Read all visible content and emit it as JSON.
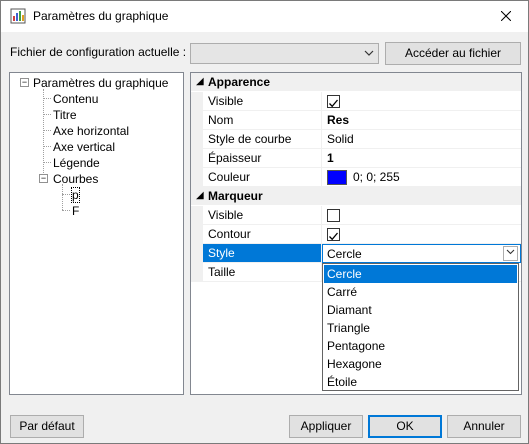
{
  "window": {
    "title": "Paramètres du graphique",
    "close_icon": "close-icon",
    "app_icon": "chart-icon"
  },
  "config": {
    "label": "Fichier de configuration actuelle :",
    "combo_value": "",
    "access_button": "Accéder au fichier"
  },
  "tree": {
    "root": "Paramètres du graphique",
    "items": [
      "Contenu",
      "Titre",
      "Axe horizontal",
      "Axe vertical",
      "Légende",
      "Courbes"
    ],
    "curves": [
      "p",
      "F"
    ],
    "selected": "p"
  },
  "grid": {
    "apparence": {
      "header": "Apparence",
      "visible_label": "Visible",
      "visible_checked": true,
      "nom_label": "Nom",
      "nom_value": "Res",
      "style_courbe_label": "Style de courbe",
      "style_courbe_value": "Solid",
      "epaisseur_label": "Épaisseur",
      "epaisseur_value": "1",
      "couleur_label": "Couleur",
      "couleur_value": "0; 0; 255",
      "couleur_swatch": "#0000ff"
    },
    "marqueur": {
      "header": "Marqueur",
      "visible_label": "Visible",
      "visible_checked": false,
      "contour_label": "Contour",
      "contour_checked": true,
      "style_label": "Style",
      "style_value": "Cercle",
      "taille_label": "Taille"
    }
  },
  "dropdown": {
    "options": [
      "Cercle",
      "Carré",
      "Diamant",
      "Triangle",
      "Pentagone",
      "Hexagone",
      "Étoile"
    ],
    "highlighted": "Cercle"
  },
  "footer": {
    "default_button": "Par défaut",
    "apply_button": "Appliquer",
    "ok_button": "OK",
    "cancel_button": "Annuler"
  },
  "colors": {
    "accent": "#0078d7"
  }
}
